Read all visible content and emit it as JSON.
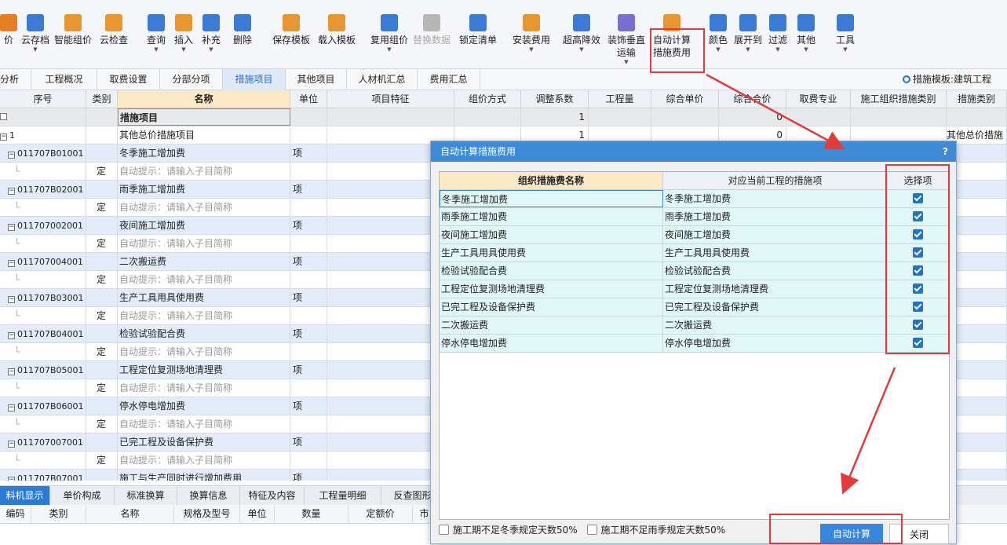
{
  "toolbar": {
    "items": [
      {
        "label": "价",
        "icon": "price-icon",
        "color": "#e67e22"
      },
      {
        "label": "云存档",
        "icon": "cloud-save-icon",
        "color": "#3a7bd5",
        "arrow": true
      },
      {
        "label": "智能组价",
        "icon": "smart-price-icon",
        "color": "#e8962f"
      },
      {
        "label": "云检查",
        "icon": "cloud-check-icon",
        "color": "#e8962f"
      },
      {
        "label": "查询",
        "icon": "query-icon",
        "color": "#3a7bd5",
        "arrow": true
      },
      {
        "label": "插入",
        "icon": "insert-icon",
        "color": "#e8962f",
        "arrow": true
      },
      {
        "label": "补充",
        "icon": "supplement-icon",
        "color": "#3a7bd5",
        "arrow": true
      },
      {
        "label": "删除",
        "icon": "delete-icon",
        "color": "#3a7bd5"
      },
      {
        "label": "保存模板",
        "icon": "save-template-icon",
        "color": "#e8962f"
      },
      {
        "label": "载入模板",
        "icon": "load-template-icon",
        "color": "#e8962f"
      },
      {
        "label": "复用组价",
        "icon": "reuse-price-icon",
        "color": "#3a7bd5",
        "arrow": true
      },
      {
        "label": "替换数据",
        "icon": "replace-data-icon",
        "color": "#b7b7b7",
        "disabled": true
      },
      {
        "label": "锁定清单",
        "icon": "lock-icon",
        "color": "#3a7bd5"
      },
      {
        "label": "安装费用",
        "icon": "install-fee-icon",
        "color": "#e8962f",
        "arrow": true
      },
      {
        "label": "超高降效",
        "icon": "height-reduce-icon",
        "color": "#3a7bd5",
        "arrow": true
      },
      {
        "label": "装饰垂直",
        "label2": "运输",
        "icon": "vertical-transport-icon",
        "color": "#7a6fd0",
        "arrow": true
      },
      {
        "label": "自动计算",
        "label2": "措施费用",
        "icon": "auto-calc-icon",
        "color": "#e8962f"
      },
      {
        "label": "颜色",
        "icon": "color-icon",
        "color": "#3a7bd5",
        "arrow": true
      },
      {
        "label": "展开到",
        "icon": "expand-icon",
        "color": "#3a7bd5",
        "arrow": true
      },
      {
        "label": "过滤",
        "icon": "filter-icon",
        "color": "#3a7bd5",
        "arrow": true
      },
      {
        "label": "其他",
        "icon": "other-icon",
        "color": "#3a7bd5",
        "arrow": true
      },
      {
        "label": "工具",
        "icon": "tools-icon",
        "color": "#3a7bd5",
        "arrow": true
      }
    ]
  },
  "tabs": [
    {
      "label": "分析"
    },
    {
      "label": "工程概况"
    },
    {
      "label": "取费设置"
    },
    {
      "label": "分部分项"
    },
    {
      "label": "措施项目",
      "active": true
    },
    {
      "label": "其他项目"
    },
    {
      "label": "人材机汇总"
    },
    {
      "label": "费用汇总"
    }
  ],
  "template_info": "措施模板:建筑工程",
  "grid": {
    "headers": [
      "序号",
      "类别",
      "名称",
      "单位",
      "项目特征",
      "组价方式",
      "调整系数",
      "工程量",
      "综合单价",
      "综合合价",
      "取费专业",
      "施工组织措施类别",
      "措施类别"
    ],
    "rows": [
      {
        "kind": "gray",
        "seq": "",
        "cat": "",
        "name": "措施项目",
        "unit": "",
        "coef": "1",
        "total": "0",
        "measure": ""
      },
      {
        "kind": "white",
        "seq": "1",
        "cat": "",
        "name": "其他总价措施项目",
        "unit": "",
        "coef": "1",
        "total": "0",
        "measure": "其他总价措施"
      },
      {
        "kind": "blue",
        "seq": "011707B01001",
        "cat": "",
        "name": "冬季施工增加费",
        "unit": "项",
        "coef": "",
        "total": "",
        "measure": ""
      },
      {
        "kind": "white",
        "seq": "",
        "cat": "定",
        "name": "自动提示：请输入子目简称",
        "hint": true
      },
      {
        "kind": "blue",
        "seq": "011707B02001",
        "cat": "",
        "name": "雨季施工增加费",
        "unit": "项"
      },
      {
        "kind": "white",
        "seq": "",
        "cat": "定",
        "name": "自动提示：请输入子目简称",
        "hint": true
      },
      {
        "kind": "blue",
        "seq": "011707002001",
        "cat": "",
        "name": "夜间施工增加费",
        "unit": "项"
      },
      {
        "kind": "white",
        "seq": "",
        "cat": "定",
        "name": "自动提示：请输入子目简称",
        "hint": true
      },
      {
        "kind": "blue",
        "seq": "011707004001",
        "cat": "",
        "name": "二次搬运费",
        "unit": "项"
      },
      {
        "kind": "white",
        "seq": "",
        "cat": "定",
        "name": "自动提示：请输入子目简称",
        "hint": true
      },
      {
        "kind": "blue",
        "seq": "011707B03001",
        "cat": "",
        "name": "生产工具用具使用费",
        "unit": "项"
      },
      {
        "kind": "white",
        "seq": "",
        "cat": "定",
        "name": "自动提示：请输入子目简称",
        "hint": true
      },
      {
        "kind": "blue",
        "seq": "011707B04001",
        "cat": "",
        "name": "检验试验配合费",
        "unit": "项"
      },
      {
        "kind": "white",
        "seq": "",
        "cat": "定",
        "name": "自动提示：请输入子目简称",
        "hint": true
      },
      {
        "kind": "blue",
        "seq": "011707B05001",
        "cat": "",
        "name": "工程定位复测场地清理费",
        "unit": "项"
      },
      {
        "kind": "white",
        "seq": "",
        "cat": "定",
        "name": "自动提示：请输入子目简称",
        "hint": true
      },
      {
        "kind": "blue",
        "seq": "011707B06001",
        "cat": "",
        "name": "停水停电增加费",
        "unit": "项"
      },
      {
        "kind": "white",
        "seq": "",
        "cat": "定",
        "name": "自动提示：请输入子目简称",
        "hint": true
      },
      {
        "kind": "blue",
        "seq": "011707007001",
        "cat": "",
        "name": "已完工程及设备保护费",
        "unit": "项"
      },
      {
        "kind": "white",
        "seq": "",
        "cat": "定",
        "name": "自动提示：请输入子目简称",
        "hint": true
      },
      {
        "kind": "blue",
        "seq": "011707B07001",
        "cat": "",
        "name": "施工与生产同时进行增加费用",
        "unit": "项"
      }
    ]
  },
  "bottom_tabs": [
    {
      "label": "料机显示",
      "active": true
    },
    {
      "label": "单价构成"
    },
    {
      "label": "标准换算"
    },
    {
      "label": "换算信息"
    },
    {
      "label": "特征及内容"
    },
    {
      "label": "工程量明细"
    },
    {
      "label": "反查图形"
    }
  ],
  "bottom_headers": [
    "编码",
    "类别",
    "名称",
    "规格及型号",
    "单位",
    "数量",
    "定额价",
    "市"
  ],
  "dialog": {
    "title": "自动计算措施费用",
    "help": "?",
    "headers": [
      "组织措施费名称",
      "对应当前工程的措施项",
      "选择项"
    ],
    "rows": [
      {
        "name": "冬季施工增加费",
        "match": "冬季施工增加费",
        "checked": true
      },
      {
        "name": "雨季施工增加费",
        "match": "雨季施工增加费",
        "checked": true
      },
      {
        "name": "夜间施工增加费",
        "match": "夜间施工增加费",
        "checked": true
      },
      {
        "name": "生产工具用具使用费",
        "match": "生产工具用具使用费",
        "checked": true
      },
      {
        "name": "检验试验配合费",
        "match": "检验试验配合费",
        "checked": true
      },
      {
        "name": "工程定位复测场地清理费",
        "match": "工程定位复测场地清理费",
        "checked": true
      },
      {
        "name": "已完工程及设备保护费",
        "match": "已完工程及设备保护费",
        "checked": true
      },
      {
        "name": "二次搬运费",
        "match": "二次搬运费",
        "checked": true
      },
      {
        "name": "停水停电增加费",
        "match": "停水停电增加费",
        "checked": true
      }
    ],
    "option_winter": "施工期不足冬季规定天数50%",
    "option_rain": "施工期不足雨季规定天数50%",
    "auto_calc_button": "自动计算",
    "close_button": "关闭"
  },
  "colors": {
    "accent": "#3586dc",
    "dialog_title": "#3e8ad6",
    "highlight_box": "#e53a3a",
    "dialog_row": "#e1f6f6",
    "grid_row": "#e3ecf8"
  }
}
